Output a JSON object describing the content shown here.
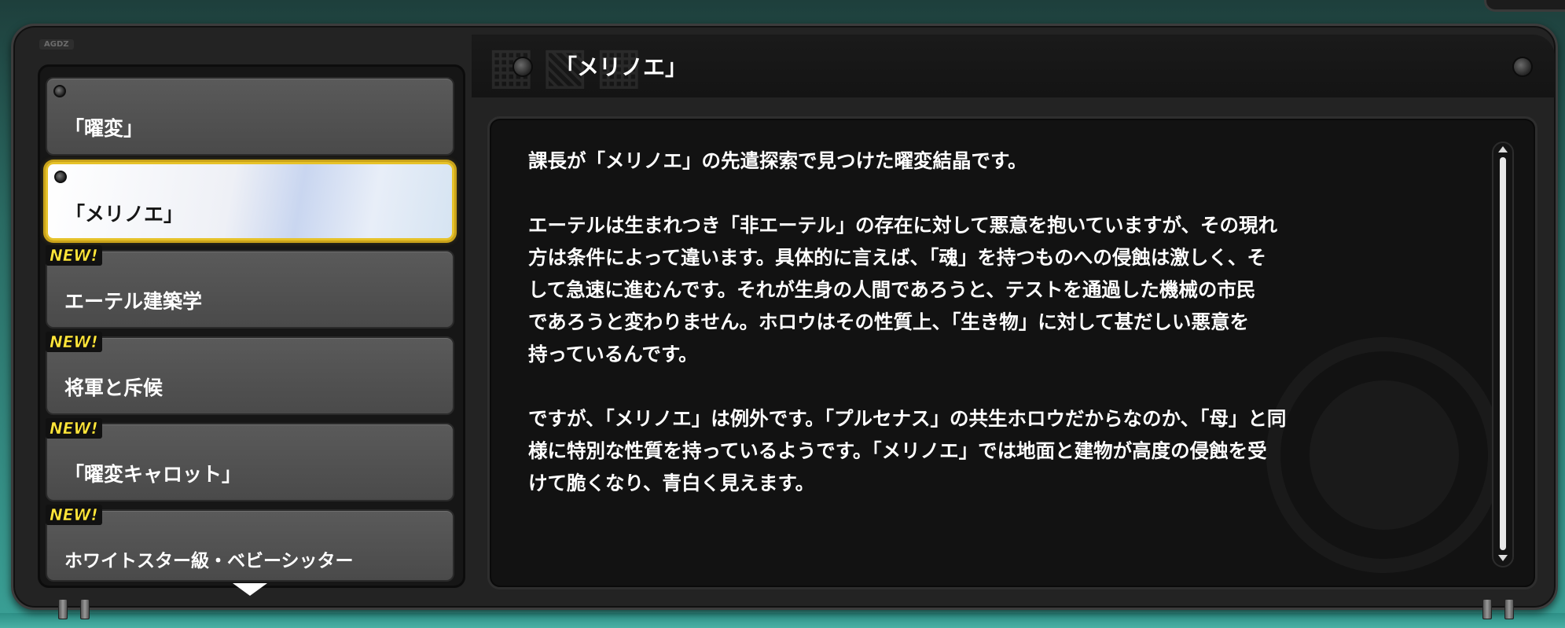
{
  "panel": {
    "code": "AGDZ"
  },
  "header": {
    "title": "「メリノエ」"
  },
  "list": {
    "items": [
      {
        "label": "「曜変」",
        "new": "",
        "selected": false
      },
      {
        "label": "「メリノエ」",
        "new": "",
        "selected": true
      },
      {
        "label": "エーテル建築学",
        "new": "NEW!",
        "selected": false
      },
      {
        "label": "将軍と斥候",
        "new": "NEW!",
        "selected": false
      },
      {
        "label": "「曜変キャロット」",
        "new": "NEW!",
        "selected": false
      },
      {
        "label": "ホワイトスター級・ベビーシッター",
        "new": "NEW!",
        "selected": false
      }
    ]
  },
  "description": {
    "paragraphs": [
      "課長が「メリノエ」の先遣探索で見つけた曜変結晶です。",
      "エーテルは生まれつき「非エーテル」の存在に対して悪意を抱いていますが、その現れ\n方は条件によって違います。具体的に言えば、「魂」を持つものへの侵蝕は激しく、そ\nして急速に進むんです。それが生身の人間であろうと、テストを通過した機械の市民\nであろうと変わりません。ホロウはその性質上、「生き物」に対して甚だしい悪意を\n持っているんです。",
      "ですが、「メリノエ」は例外です。「プルセナス」の共生ホロウだからなのか、「母」と同\n様に特別な性質を持っているようです。「メリノエ」では地面と建物が高度の侵蝕を受\nけて脆くなり、青白く見えます。"
    ]
  },
  "icons": {
    "header_left_dot": "rivet-dot-icon",
    "header_right_dot": "rivet-dot-icon",
    "scroll_indicator": "chevron-down-icon",
    "emblem": "faction-emblem-icon"
  },
  "colors": {
    "panel_bg": "#232323",
    "selected_border": "#e6c229",
    "new_badge": "#ffe53a",
    "text": "#ffffff",
    "background_teal": "#3aa096"
  }
}
